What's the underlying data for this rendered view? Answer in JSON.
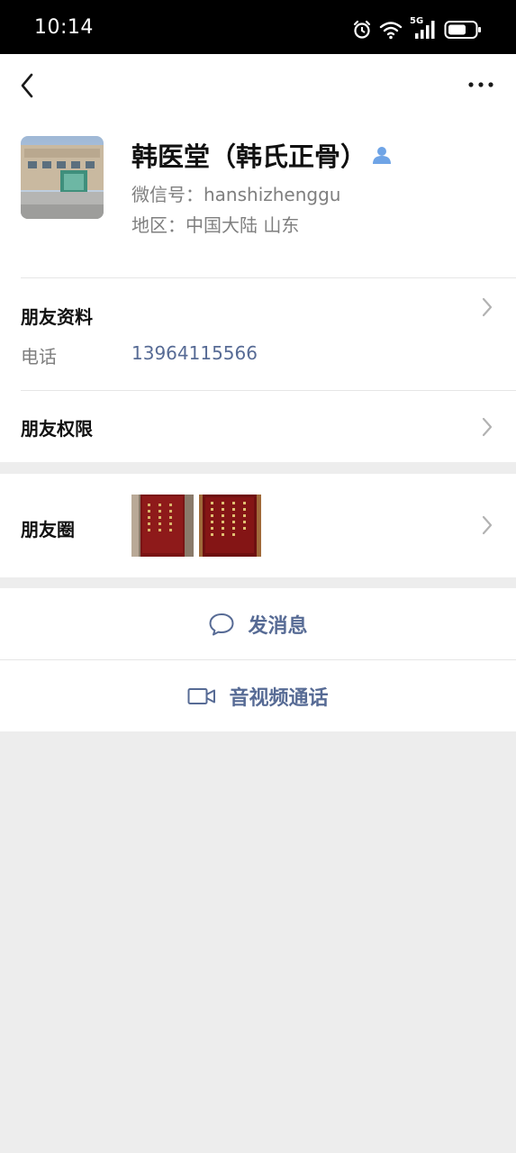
{
  "status_bar": {
    "time": "10:14",
    "network_label": "5G",
    "icons": [
      "alarm-icon",
      "wifi-icon",
      "signal-5g-icon",
      "battery-icon"
    ]
  },
  "nav": {
    "back_icon": "chevron-left-icon",
    "more_icon": "more-dots-icon"
  },
  "profile": {
    "nickname": "韩医堂（韩氏正骨）",
    "wechat_id": "微信号：hanshizhenggu",
    "region": "地区：中国大陆  山东"
  },
  "friend_info": {
    "title": "朋友资料",
    "phone_label": "电话",
    "phone_value": "13964115566"
  },
  "permissions": {
    "title": "朋友权限"
  },
  "moments": {
    "title": "朋友圈"
  },
  "actions": {
    "message_label": "发消息",
    "call_label": "音视频通话"
  },
  "colors": {
    "link_blue": "#576b95",
    "badge_blue": "#6fa4e6",
    "background": "#ededed"
  }
}
